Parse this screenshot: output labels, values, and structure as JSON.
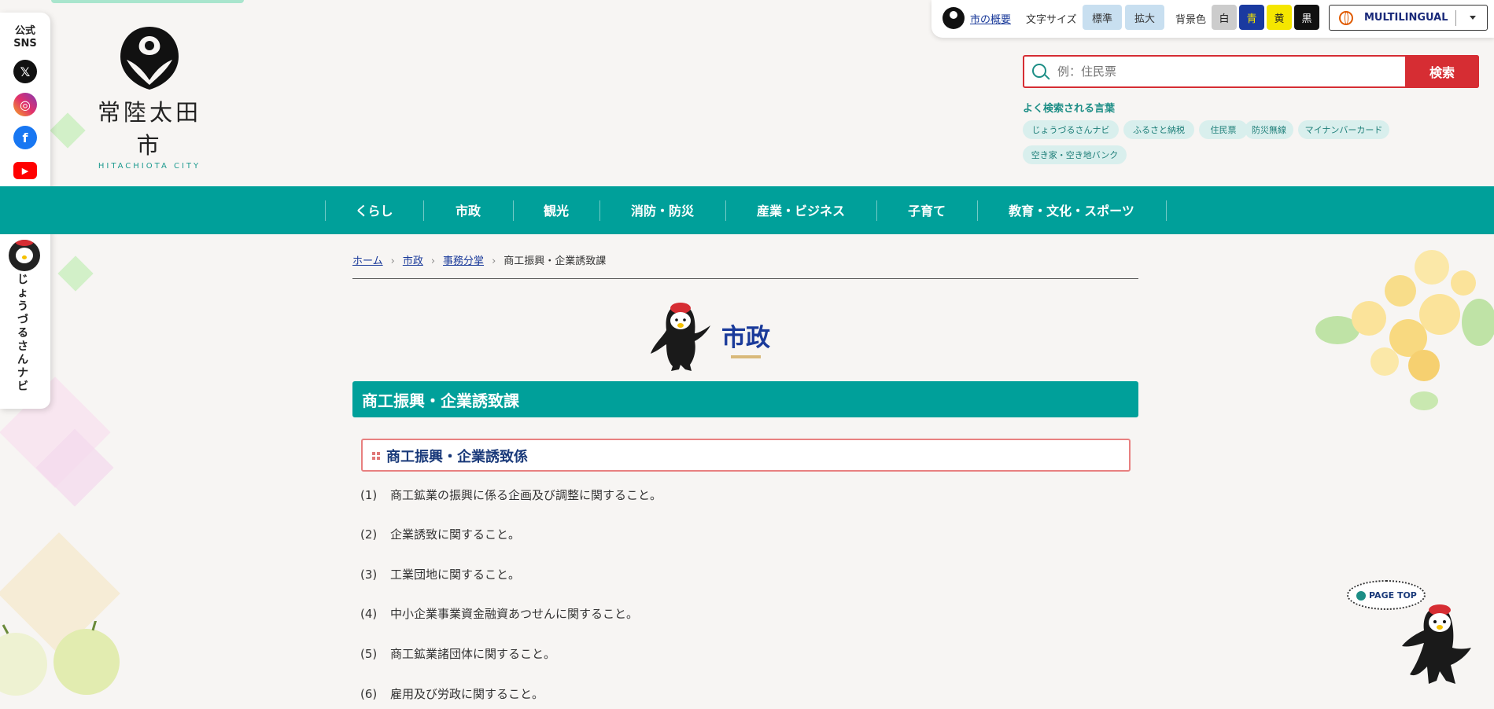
{
  "sns": {
    "title_line1": "公式",
    "title_line2": "SNS",
    "items": [
      {
        "name": "X",
        "glyph": "𝕏"
      },
      {
        "name": "Instagram",
        "glyph": "◎"
      },
      {
        "name": "Facebook",
        "glyph": "f"
      },
      {
        "name": "YouTube",
        "glyph": "▶"
      }
    ]
  },
  "navi": {
    "label": "じょうづるさんナビ"
  },
  "logo": {
    "name": "常陸太田市",
    "en": "HITACHIOTA CITY"
  },
  "toolbar": {
    "about": "市の概要",
    "font_size_label": "文字サイズ",
    "font_standard": "標準",
    "font_large": "拡大",
    "bg_label": "背景色",
    "bg_white": "白",
    "bg_blue": "青",
    "bg_yellow": "黄",
    "bg_black": "黒",
    "multilingual": "MULTILINGUAL"
  },
  "search": {
    "placeholder": "例：住民票",
    "button": "検索",
    "frequent_title": "よく検索される言葉",
    "tags": [
      "じょうづるさんナビ",
      "ふるさと納税",
      "住民票",
      "防災無線",
      "マイナンバーカード",
      "空き家・空き地バンク"
    ]
  },
  "nav": {
    "items": [
      "くらし",
      "市政",
      "観光",
      "消防・防災",
      "産業・ビジネス",
      "子育て",
      "教育・文化・スポーツ"
    ]
  },
  "breadcrumb": {
    "home": "ホーム",
    "level1": "市政",
    "level2": "事務分掌",
    "current": "商工振興・企業誘致課"
  },
  "page": {
    "category_title": "市政",
    "dept_title": "商工振興・企業誘致課",
    "section_title": "商工振興・企業誘致係"
  },
  "duties": [
    {
      "num": "(1)",
      "text": "商工鉱業の振興に係る企画及び調整に関すること。"
    },
    {
      "num": "(2)",
      "text": "企業誘致に関すること。"
    },
    {
      "num": "(3)",
      "text": "工業団地に関すること。"
    },
    {
      "num": "(4)",
      "text": "中小企業事業資金融資あつせんに関すること。"
    },
    {
      "num": "(5)",
      "text": "商工鉱業諸団体に関すること。"
    },
    {
      "num": "(6)",
      "text": "雇用及び労政に関すること。"
    }
  ],
  "pagetop": {
    "label": "PAGE TOP"
  },
  "colors": {
    "teal": "#00a09a",
    "red": "#d62d33",
    "navy": "#1a3a9a"
  }
}
